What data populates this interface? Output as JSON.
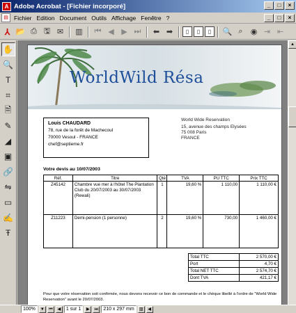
{
  "window": {
    "title": "Adobe Acrobat - [Fichier incorporé]",
    "controls": [
      "_",
      "□",
      "×"
    ]
  },
  "menubar": {
    "items": [
      "Fichier",
      "Edition",
      "Document",
      "Outils",
      "Affichage",
      "Fenêtre",
      "?"
    ],
    "doc_controls": [
      "_",
      "□",
      "×"
    ]
  },
  "document": {
    "logo": {
      "part1": "WorldWild ",
      "part2": "Résa"
    },
    "client": {
      "name": "Louis CHAUDARD",
      "address1": "78, rue de la forêt de Machecoul",
      "address2": "70000 Vesoul - FRANCE",
      "email": "chef@septieme.fr"
    },
    "agency": {
      "name": "World Wide Reservation",
      "address1": "15, avenue des champs Elysées",
      "address2": "75 008 Paris",
      "country": "FRANCE"
    },
    "quote_title": "Votre devis au 10/07/2003",
    "table": {
      "headers": [
        "Réf.",
        "Titre",
        "Qté",
        "TVA",
        "PU TTC",
        "Prix TTC"
      ],
      "rows": [
        {
          "ref": "Z45142",
          "title": "Chambre vue mer à l'hôtel The Plantation Club du 20/07/2003 au 30/07/2003 (Rewali)",
          "qty": "1",
          "tva": "19,60 %",
          "pu": "1 110,00",
          "prix": "1 110,00 €"
        },
        {
          "ref": "Z11223",
          "title": "Demi-pension (1 personne)",
          "qty": "2",
          "tva": "19,60 %",
          "pu": "730,00",
          "prix": "1 460,00 €"
        }
      ]
    },
    "totals": [
      {
        "label": "Total TTC",
        "value": "2 570,00 €"
      },
      {
        "label": "Port",
        "value": "4,70 €"
      },
      {
        "label": "Total NET TTC",
        "value": "2 574,70 €"
      },
      {
        "label": "Dont TVA",
        "value": "421,17 €"
      }
    ],
    "footer": "Pour que votre réservation soit confirmée, nous devons recevoir ce bon de commande et le chèque libellé à l'ordre de \"World Wide Reservation\" avant le 20/07/2003."
  },
  "statusbar": {
    "zoom": "100%",
    "page": "1 sur 1",
    "size": "210 x 297 mm"
  }
}
